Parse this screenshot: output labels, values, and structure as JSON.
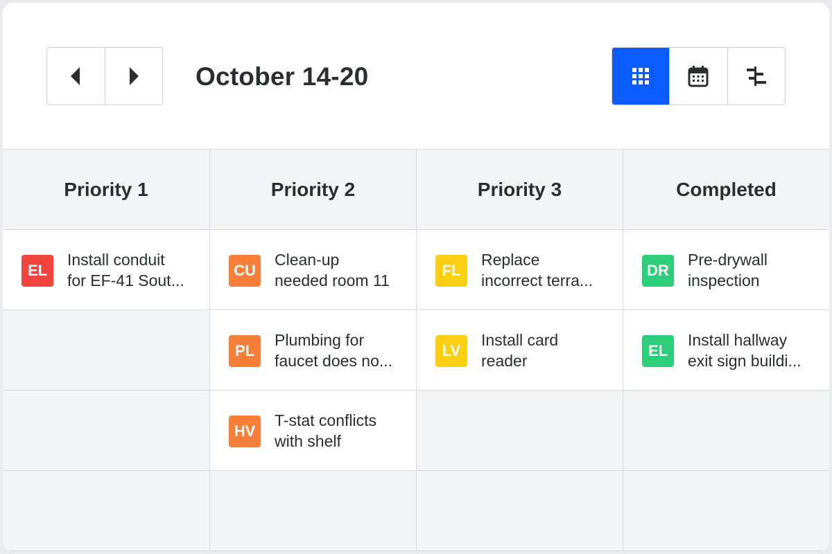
{
  "header": {
    "date_range": "October 14-20",
    "prev_icon": "caret-left-icon",
    "next_icon": "caret-right-icon",
    "views": [
      {
        "icon": "grid-view-icon",
        "active": true
      },
      {
        "icon": "calendar-view-icon",
        "active": false
      },
      {
        "icon": "gantt-view-icon",
        "active": false
      }
    ]
  },
  "colors": {
    "accent": "#0a5cff",
    "red": "#f0443c",
    "orange": "#f77f3a",
    "yellow": "#fccf12",
    "green": "#2ecd79"
  },
  "columns": [
    {
      "title": "Priority 1",
      "cards": [
        {
          "initials": "EL",
          "color": "#f0443c",
          "line1": "Install conduit",
          "line2": "for EF-41 Sout..."
        }
      ]
    },
    {
      "title": "Priority 2",
      "cards": [
        {
          "initials": "CU",
          "color": "#f77f3a",
          "line1": "Clean-up",
          "line2": "needed room 11"
        },
        {
          "initials": "PL",
          "color": "#f77f3a",
          "line1": "Plumbing for",
          "line2": "faucet does no..."
        },
        {
          "initials": "HV",
          "color": "#f77f3a",
          "line1": "T-stat conflicts",
          "line2": "with shelf"
        }
      ]
    },
    {
      "title": "Priority 3",
      "cards": [
        {
          "initials": "FL",
          "color": "#fccf12",
          "line1": "Replace",
          "line2": "incorrect terra..."
        },
        {
          "initials": "LV",
          "color": "#fccf12",
          "line1": "Install card",
          "line2": "reader"
        }
      ]
    },
    {
      "title": "Completed",
      "cards": [
        {
          "initials": "DR",
          "color": "#2ecd79",
          "line1": "Pre-drywall",
          "line2": "inspection"
        },
        {
          "initials": "EL",
          "color": "#2ecd79",
          "line1": "Install hallway",
          "line2": "exit sign buildi..."
        }
      ]
    }
  ]
}
